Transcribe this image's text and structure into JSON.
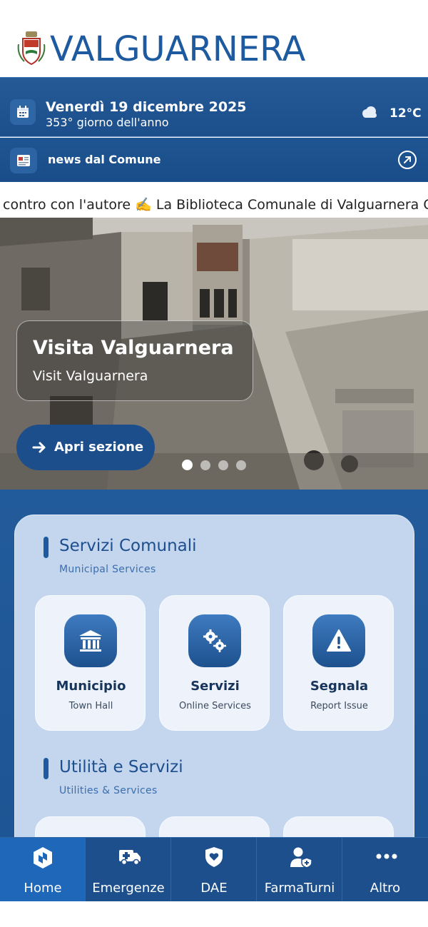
{
  "header": {
    "app_title": "VALGUARNERA",
    "crest_icon": "town-crest-icon"
  },
  "date_bar": {
    "date": "Venerdì 19 dicembre 2025",
    "day_of_year": "353° giorno dell'anno",
    "weather_icon": "cloud-icon",
    "temperature": "12°C"
  },
  "news_bar": {
    "label": "news dal Comune",
    "open_icon": "external-open-icon"
  },
  "ticker": {
    "text": "contro con l'autore ✍️ La Biblioteca Comunale di Valguarnera C"
  },
  "hero": {
    "title": "Visita Valguarnera",
    "subtitle": "Visit Valguarnera",
    "button_label": "Apri sezione",
    "slides_count": 4,
    "active_slide": 1
  },
  "sections": [
    {
      "title": "Servizi Comunali",
      "subtitle": "Municipal Services",
      "tiles": [
        {
          "title": "Municipio",
          "subtitle": "Town Hall",
          "icon": "town-hall-icon"
        },
        {
          "title": "Servizi",
          "subtitle": "Online Services",
          "icon": "gears-icon"
        },
        {
          "title": "Segnala",
          "subtitle": "Report Issue",
          "icon": "warning-icon"
        }
      ]
    },
    {
      "title": "Utilità e Servizi",
      "subtitle": "Utilities & Services"
    }
  ],
  "bottom_nav": [
    {
      "label": "Home",
      "icon": "home-icon",
      "active": true
    },
    {
      "label": "Emergenze",
      "icon": "ambulance-icon",
      "active": false
    },
    {
      "label": "DAE",
      "icon": "shield-heart-icon",
      "active": false
    },
    {
      "label": "FarmaTurni",
      "icon": "pharmacist-icon",
      "active": false
    },
    {
      "label": "Altro",
      "icon": "more-dots-icon",
      "active": false
    }
  ],
  "colors": {
    "brand_blue": "#1d4f8d",
    "title_blue": "#1d5a9f",
    "panel_bg": "#c4d6ee"
  }
}
